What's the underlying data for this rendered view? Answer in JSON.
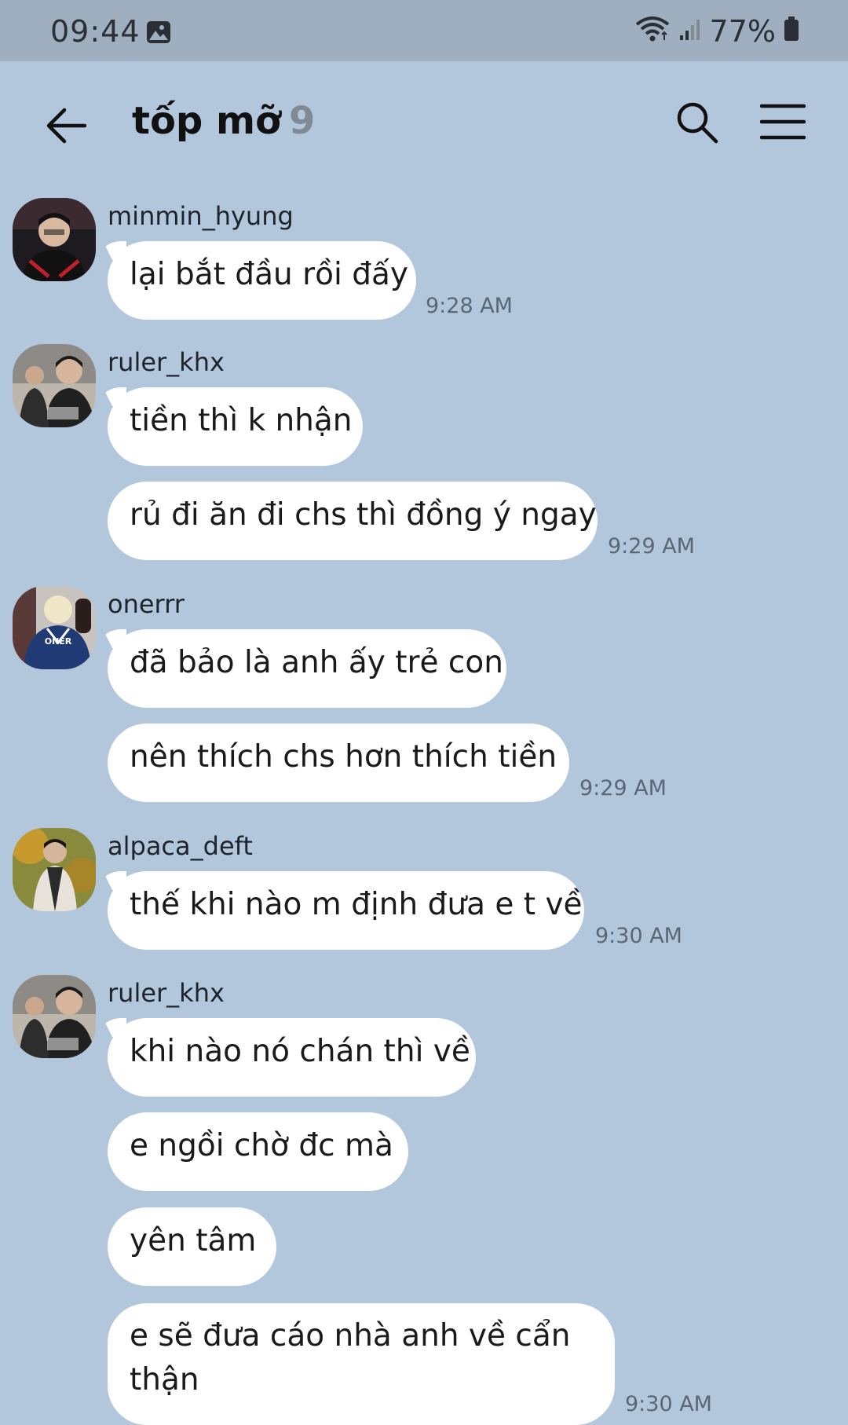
{
  "status_bar": {
    "time": "09:44",
    "battery": "77%",
    "icons": [
      "image-icon",
      "wifi-icon",
      "signal-icon",
      "battery-icon"
    ]
  },
  "header": {
    "title": "tốp mỡ",
    "member_count": "9",
    "icons": [
      "back-arrow-icon",
      "search-icon",
      "menu-icon"
    ]
  },
  "messages": [
    {
      "sender": "minmin_hyung",
      "bubbles": [
        "lại bắt đầu rồi đấy"
      ],
      "time": "9:28 AM"
    },
    {
      "sender": "ruler_khx",
      "bubbles": [
        "tiền thì k nhận",
        "rủ đi ăn đi chs thì đồng ý ngay"
      ],
      "time": "9:29 AM"
    },
    {
      "sender": "onerrr",
      "bubbles": [
        "đã bảo là anh ấy trẻ con",
        "nên thích chs hơn thích tiền"
      ],
      "time": "9:29 AM"
    },
    {
      "sender": "alpaca_deft",
      "bubbles": [
        "thế khi nào m định đưa e t về"
      ],
      "time": "9:30 AM"
    },
    {
      "sender": "ruler_khx",
      "bubbles": [
        "khi nào nó chán thì về",
        "e ngồi chờ đc mà",
        "yên tâm",
        "e sẽ đưa cáo nhà anh về cẩn thận"
      ],
      "time": "9:30 AM"
    }
  ],
  "avatar_jersey_text": "ONER",
  "colors": {
    "background": "#b2c7dc",
    "status_bar": "#9fafc0",
    "bubble": "#ffffff",
    "timestamp": "#5a6775"
  }
}
